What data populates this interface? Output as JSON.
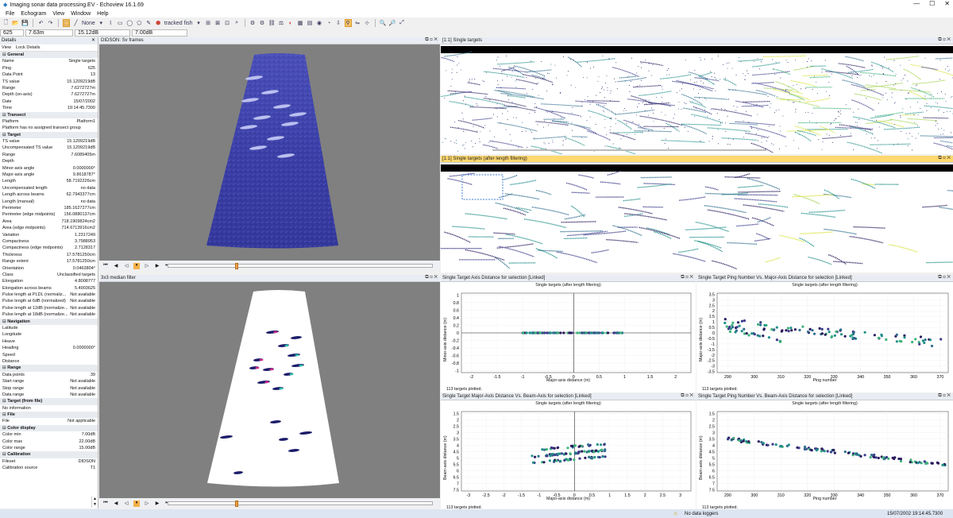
{
  "app": {
    "title": "Imaging sonar data processing.EV - Echoview 16.1.69",
    "brand": "echoview",
    "menu": [
      "File",
      "Echogram",
      "View",
      "Window",
      "Help"
    ],
    "window_controls": [
      "—",
      "☐",
      "✕"
    ]
  },
  "toolbar": {
    "line_label": "None",
    "fish_label": "tracked fish"
  },
  "readout": {
    "ping": "625",
    "range": "7.63m",
    "value": "15.12dB",
    "value2": "7.00dB"
  },
  "details": {
    "title": "Details",
    "menu": [
      "View",
      "Lock Details"
    ],
    "rows": [
      {
        "t": "sec",
        "k": "General"
      },
      {
        "k": "Name",
        "v": "Single targets"
      },
      {
        "k": "Ping",
        "v": "625"
      },
      {
        "k": "Data Point",
        "v": "13"
      },
      {
        "k": "TS value",
        "v": "15.1209219dB"
      },
      {
        "k": "Range",
        "v": "7.6272727m"
      },
      {
        "k": "Depth (on-axis)",
        "v": "7.6272727m"
      },
      {
        "k": "Date",
        "v": "15/07/2002"
      },
      {
        "k": "Time",
        "v": "19:14:45.7300"
      },
      {
        "t": "sec",
        "k": "Transect"
      },
      {
        "k": "Platform",
        "v": "Platform1"
      },
      {
        "t": "note",
        "k": "Platform has no assigned transect group"
      },
      {
        "t": "sec",
        "k": "Target"
      },
      {
        "k": "TS value",
        "v": "15.1209219dB"
      },
      {
        "k": "Uncompensated TS value",
        "v": "15.1209219dB"
      },
      {
        "k": "Range",
        "v": "7.6089405m"
      },
      {
        "k": "Depth",
        "v": ""
      },
      {
        "k": "Minor-axis angle",
        "v": "0.0000000°"
      },
      {
        "k": "Major-axis angle",
        "v": "9.8618787°"
      },
      {
        "k": "Length",
        "v": "58.7192226cm"
      },
      {
        "k": "Uncompensated length",
        "v": "no data"
      },
      {
        "k": "Length across beams",
        "v": "62.7943377cm"
      },
      {
        "k": "Length (manual)",
        "v": "no data"
      },
      {
        "k": "Perimeter",
        "v": "185.1627277cm"
      },
      {
        "k": "Perimeter (edge midpoints)",
        "v": "156.0880137cm"
      },
      {
        "k": "Area",
        "v": "718.1909824cm2"
      },
      {
        "k": "Area (edge midpoints)",
        "v": "714.6713916cm2"
      },
      {
        "k": "Variation",
        "v": "1.2317249"
      },
      {
        "k": "Compactness",
        "v": "3.7988953"
      },
      {
        "k": "Compactness (edge midpoints)",
        "v": "2.7128317"
      },
      {
        "k": "Thickness",
        "v": "17.5781250cm"
      },
      {
        "k": "Range extent",
        "v": "17.5781250cm"
      },
      {
        "k": "Orientation",
        "v": "0.0463804°"
      },
      {
        "k": "Class",
        "v": "Unclassified targets"
      },
      {
        "k": "Elongation",
        "v": "4.8008777"
      },
      {
        "k": "Elongation across beams",
        "v": "5.4903625"
      },
      {
        "k": "Pulse length at PLDL (normaliz...",
        "v": "Not available"
      },
      {
        "k": "Pulse length at 6dB (normalized)",
        "v": "Not available"
      },
      {
        "k": "Pulse length at 12dB (normalize...",
        "v": "Not available"
      },
      {
        "k": "Pulse length at 18dB (normalize...",
        "v": "Not available"
      },
      {
        "t": "sec",
        "k": "Navigation"
      },
      {
        "k": "Latitude",
        "v": ""
      },
      {
        "k": "Longitude",
        "v": ""
      },
      {
        "k": "Heave",
        "v": ""
      },
      {
        "k": "Heading",
        "v": "0.0000000°"
      },
      {
        "k": "Speed",
        "v": ""
      },
      {
        "k": "Distance",
        "v": ""
      },
      {
        "t": "sec",
        "k": "Range"
      },
      {
        "k": "Data points",
        "v": "39"
      },
      {
        "k": "Start range",
        "v": "Not available"
      },
      {
        "k": "Stop range",
        "v": "Not available"
      },
      {
        "k": "Data range",
        "v": "Not available"
      },
      {
        "t": "sec",
        "k": "Target (from file)"
      },
      {
        "t": "note",
        "k": "No information"
      },
      {
        "t": "sec",
        "k": "File"
      },
      {
        "k": "File",
        "v": "Not applicable"
      },
      {
        "t": "sec",
        "k": "Color display"
      },
      {
        "k": "Color min",
        "v": "7.00dB"
      },
      {
        "k": "Color max",
        "v": "22.00dB"
      },
      {
        "k": "Color range",
        "v": "15.00dB"
      },
      {
        "t": "sec",
        "k": "Calibration"
      },
      {
        "k": "Fileset",
        "v": "DIDSON"
      },
      {
        "k": "Calibration source",
        "v": "T1"
      }
    ]
  },
  "panels": {
    "didson": {
      "title": "DIDSON: Sv frames"
    },
    "median": {
      "title": "3x3 median filter"
    },
    "st1": {
      "title": "[1:1]  Single targets"
    },
    "st2": {
      "title": "[1:1]  Single targets (after length filtering)"
    },
    "controls": "⧉ ◻ ✕"
  },
  "plots": [
    {
      "title": "Single Target Axis Distance for selection [Linked]",
      "subtitle": "Single targets (after length filtering)",
      "xlabel": "Major-axis distance (m)",
      "ylabel": "Minor-axis distance (m)",
      "footer": "113 targets plotted."
    },
    {
      "title": "Single Target Ping Number Vs. Major-Axis Distance for selection [Linked]",
      "subtitle": "Single targets (after length filtering)",
      "xlabel": "Ping number",
      "ylabel": "Major-axis distance (m)",
      "footer": "113 targets plotted."
    },
    {
      "title": "Single Target Major-Axis Distance Vs. Beam-Axis for selection [Linked]",
      "subtitle": "Single targets (after length filtering)",
      "xlabel": "Major-axis distance (m)",
      "ylabel": "Beam-axis distance (m)",
      "footer": "113 targets plotted."
    },
    {
      "title": "Single Target Ping Number Vs. Beam-Axis Distance for selection [Linked]",
      "subtitle": "Single targets (after length filtering)",
      "xlabel": "Ping number",
      "ylabel": "Beam-axis distance (m)",
      "footer": "113 targets plotted."
    }
  ],
  "chart_data": [
    {
      "type": "scatter",
      "x_ticks": [
        "-2",
        "-1.5",
        "-1",
        "-0.5",
        "0",
        "0.5",
        "1",
        "1.5",
        "2"
      ],
      "y_ticks": [
        "1",
        "0.8",
        "0.6",
        "0.4",
        "0.2",
        "0",
        "-0.2",
        "-0.4",
        "-0.6",
        "-0.8",
        "-1"
      ],
      "xlim": [
        -2.2,
        2.3
      ],
      "ylim": [
        -1.05,
        1.05
      ],
      "x_range": [
        -1.0,
        1.0
      ],
      "y_value": 0
    },
    {
      "type": "scatter",
      "x_ticks": [
        "290",
        "300",
        "310",
        "320",
        "330",
        "340",
        "350",
        "360",
        "370"
      ],
      "y_ticks": [
        "3.5",
        "3",
        "2.5",
        "2",
        "1.5",
        "1",
        "0.5",
        "0",
        "-0.5",
        "-1",
        "-1.5",
        "-2",
        "-2.5",
        "-3",
        "-3.5"
      ],
      "xlim": [
        286,
        373
      ],
      "ylim": [
        -3.6,
        3.6
      ]
    },
    {
      "type": "scatter",
      "x_ticks": [
        "-3",
        "-2.5",
        "-2",
        "-1.5",
        "-1",
        "-0.5",
        "0",
        "0.5",
        "1",
        "1.5",
        "2",
        "2.5",
        "3"
      ],
      "y_ticks": [
        "1.5",
        "2",
        "2.5",
        "3",
        "3.5",
        "4",
        "4.5",
        "5",
        "5.5",
        "6",
        "6.5",
        "7",
        "7.5"
      ],
      "xlim": [
        -3.2,
        3.3
      ],
      "ylim": [
        1.35,
        7.6
      ]
    },
    {
      "type": "scatter",
      "x_ticks": [
        "290",
        "300",
        "310",
        "320",
        "330",
        "340",
        "350",
        "360",
        "370"
      ],
      "y_ticks": [
        "1.5",
        "2",
        "2.5",
        "3",
        "3.5",
        "4",
        "4.5",
        "5",
        "5.5",
        "6",
        "6.5",
        "7",
        "7.5"
      ],
      "xlim": [
        286,
        373
      ],
      "ylim": [
        1.35,
        7.6
      ]
    }
  ],
  "status": {
    "loggers": "No data loggers",
    "datetime": "15/07/2002 19:14:45.7300"
  }
}
